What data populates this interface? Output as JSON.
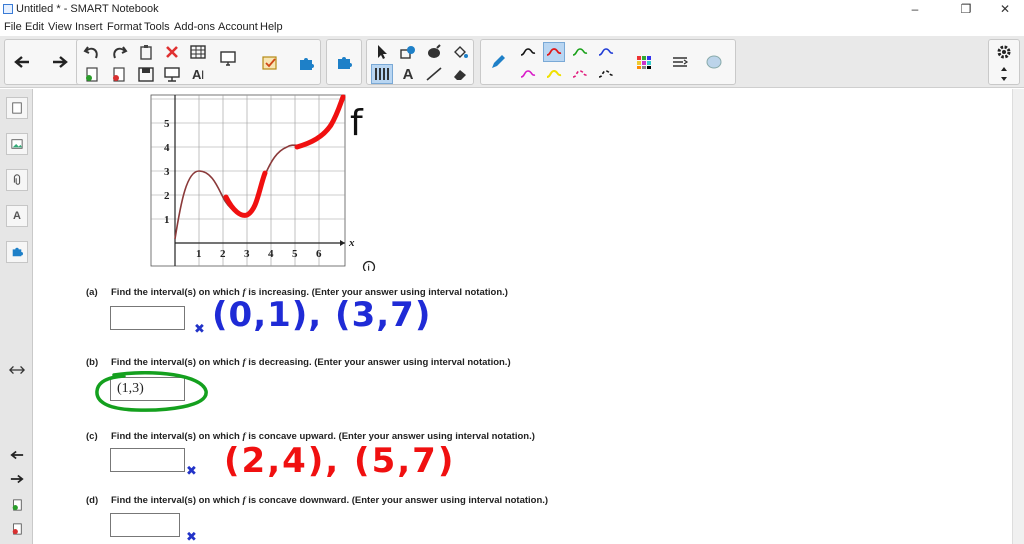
{
  "window": {
    "title": "Untitled * - SMART Notebook",
    "buttons": {
      "minimize": "–",
      "maximize": "❐",
      "close": "✕"
    }
  },
  "menu": [
    "File",
    "Edit",
    "View",
    "Insert",
    "Format",
    "Tools",
    "Add-ons",
    "Account",
    "Help"
  ],
  "toolbar": {
    "text_tool_label": "A"
  },
  "leftpanel": {
    "properties_label": "A"
  },
  "graph": {
    "x_ticks": [
      "1",
      "2",
      "3",
      "4",
      "5",
      "6"
    ],
    "y_ticks": [
      "1",
      "2",
      "3",
      "4",
      "5"
    ],
    "x_axis_label": "x",
    "info_glyph": "i",
    "function_label": "f"
  },
  "questions": [
    {
      "label": "(a)",
      "pre": "Find the interval(s) on which ",
      "fn": "f",
      "post": " is increasing. (Enter your answer using interval notation.)",
      "box": "",
      "mark": "✖"
    },
    {
      "label": "(b)",
      "pre": "Find the interval(s) on which ",
      "fn": "f",
      "post": " is decreasing. (Enter your answer using interval notation.)",
      "box": "(1,3)",
      "mark": ""
    },
    {
      "label": "(c)",
      "pre": "Find the interval(s) on which ",
      "fn": "f",
      "post": " is concave upward. (Enter your answer using interval notation.)",
      "box": "",
      "mark": "✖"
    },
    {
      "label": "(d)",
      "pre": "Find the interval(s) on which ",
      "fn": "f",
      "post": " is concave downward. (Enter your answer using interval notation.)",
      "box": "",
      "mark": "✖"
    }
  ],
  "handwriting": {
    "increasing": "(0,1), (3,7)",
    "concave_up": "(2,4), (5,7)"
  },
  "colors": {
    "ink_blue": "#1f2bd6",
    "ink_red": "#f01010",
    "ink_green": "#14a01e",
    "curve": "#8b3a3a"
  }
}
